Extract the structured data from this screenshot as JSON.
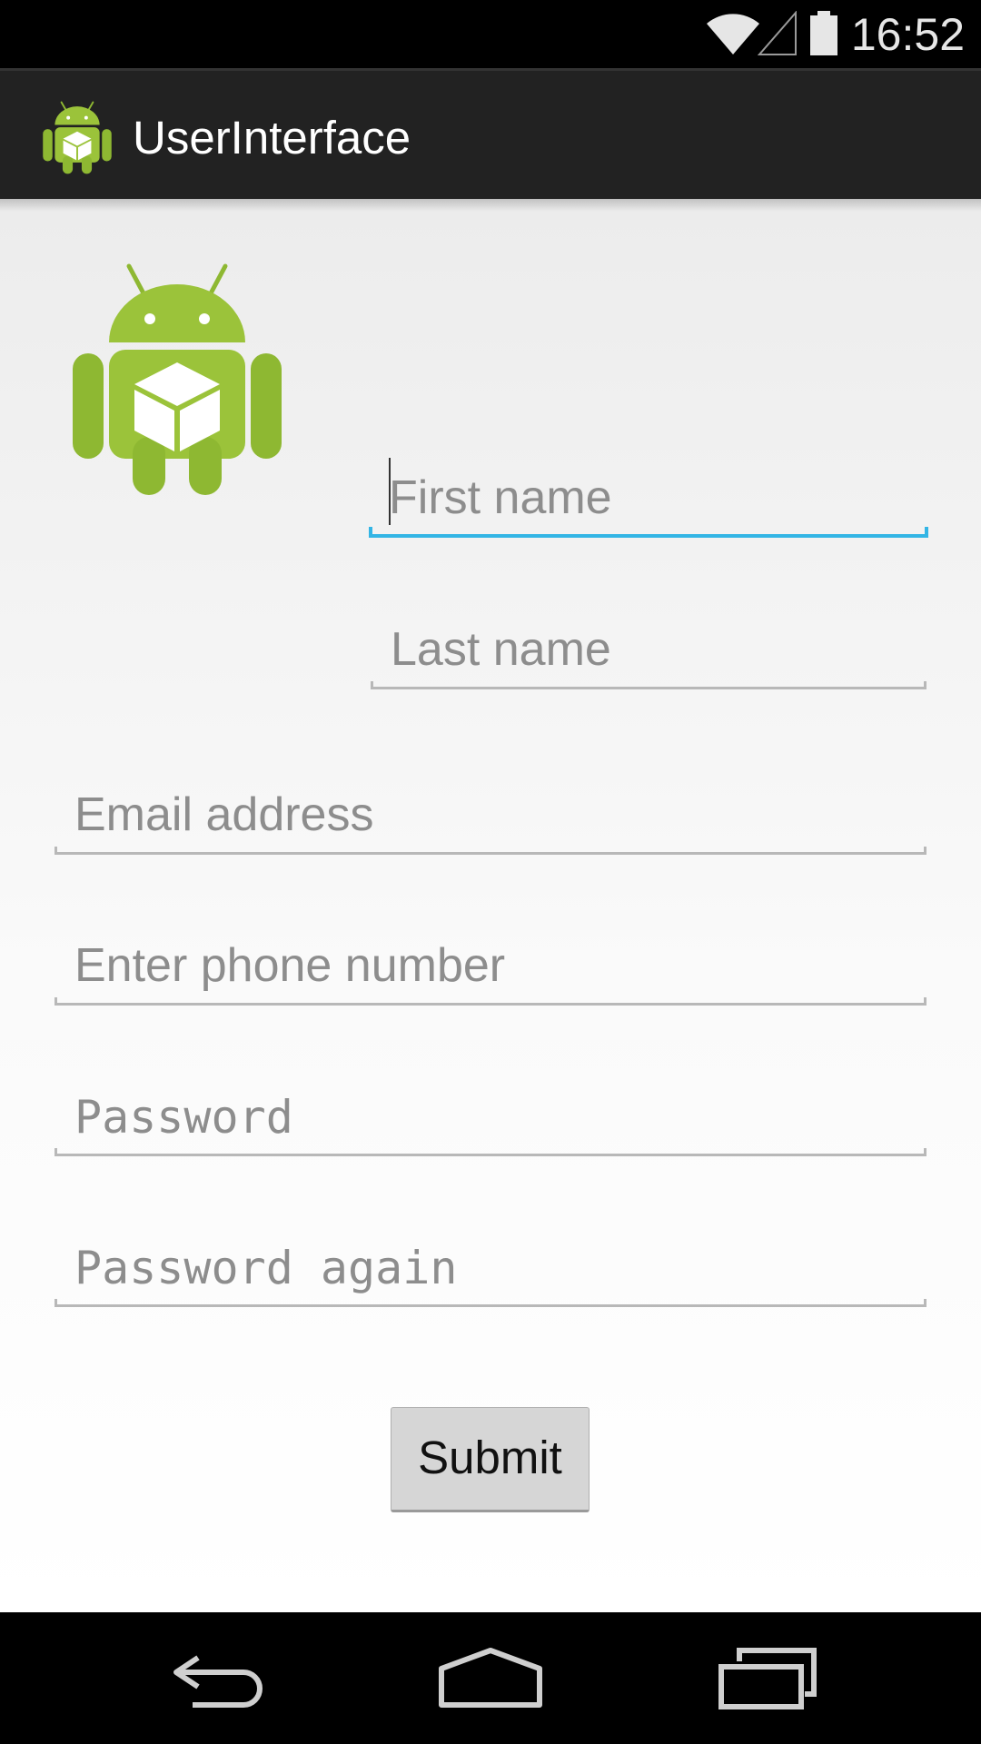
{
  "status_bar": {
    "time": "16:52",
    "icons": [
      "wifi-icon",
      "signal-icon",
      "battery-icon"
    ]
  },
  "action_bar": {
    "title": "UserInterface",
    "icon": "android-app-icon"
  },
  "form": {
    "first_name_placeholder": "First name",
    "last_name_placeholder": "Last name",
    "email_placeholder": "Email address",
    "phone_placeholder": "Enter phone number",
    "password_placeholder": "Password",
    "password_again_placeholder": "Password again",
    "submit_label": "Submit"
  },
  "nav_bar": {
    "icons": [
      "back-icon",
      "home-icon",
      "recents-icon"
    ]
  },
  "colors": {
    "focus_accent": "#33b5e5",
    "android_green": "#9bc33a",
    "action_bar_bg": "#222222"
  }
}
